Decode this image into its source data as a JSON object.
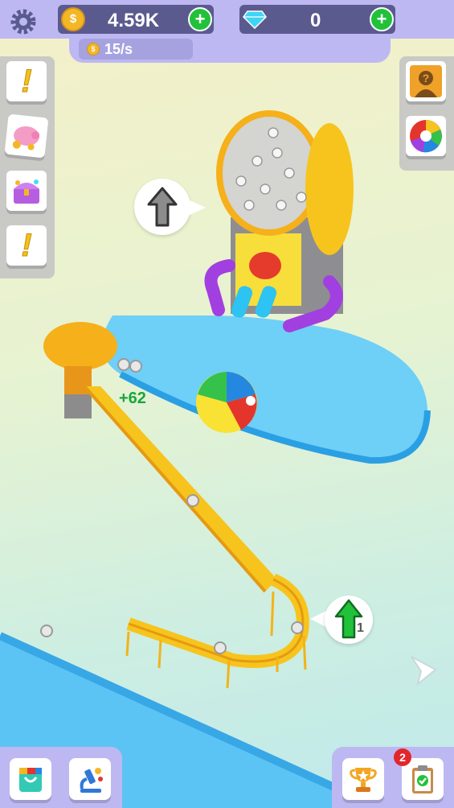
{
  "hud": {
    "coins": {
      "value": "4.59K",
      "icon": "coin-icon"
    },
    "gems": {
      "value": "0",
      "icon": "diamond-icon"
    },
    "rate": "15/s",
    "coin_symbol": "$"
  },
  "game": {
    "floating_reward": "+62",
    "upgrade_level": "1"
  },
  "bottom": {
    "tasks_badge": "2"
  },
  "colors": {
    "accent": "#bdb8f2",
    "hud_pill": "#5b5a8f",
    "add": "#22c13a",
    "water": "#5cc4f5",
    "track": "#f6c31c"
  }
}
